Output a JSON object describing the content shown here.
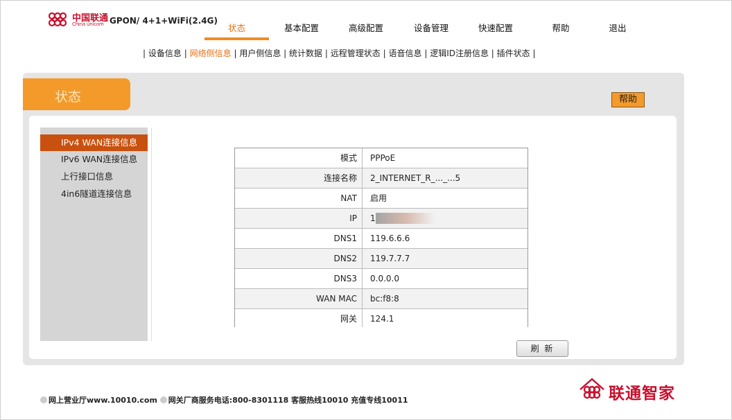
{
  "header": {
    "logo_cn": "中国联通",
    "logo_en": "China unicom",
    "model": "GPON/ 4+1+WiFi(2.4G)",
    "nav": [
      {
        "label": "状态",
        "active": true
      },
      {
        "label": "基本配置",
        "active": false
      },
      {
        "label": "高级配置",
        "active": false
      },
      {
        "label": "设备管理",
        "active": false
      },
      {
        "label": "快速配置",
        "active": false
      },
      {
        "label": "帮助",
        "active": false
      },
      {
        "label": "退出",
        "active": false
      }
    ],
    "subnav": [
      {
        "label": "设备信息",
        "active": false
      },
      {
        "label": "网络侧信息",
        "active": true
      },
      {
        "label": "用户侧信息",
        "active": false
      },
      {
        "label": "统计数据",
        "active": false
      },
      {
        "label": "远程管理状态",
        "active": false
      },
      {
        "label": "语音信息",
        "active": false
      },
      {
        "label": "逻辑ID注册信息",
        "active": false
      },
      {
        "label": "插件状态",
        "active": false
      }
    ],
    "subnav_sep": "|"
  },
  "panel": {
    "title": "状态",
    "help_label": "帮助",
    "refresh_label": "刷 新"
  },
  "sidebar": {
    "items": [
      {
        "label": "IPv4 WAN连接信息",
        "active": true
      },
      {
        "label": "IPv6 WAN连接信息",
        "active": false
      },
      {
        "label": "上行接口信息",
        "active": false
      },
      {
        "label": "4in6隧道连接信息",
        "active": false
      }
    ]
  },
  "info": {
    "rows": [
      {
        "key": "模式",
        "value": "PPPoE"
      },
      {
        "key": "连接名称",
        "value": "2_INTERNET_R_..._...5"
      },
      {
        "key": "NAT",
        "value": "启用"
      },
      {
        "key": "IP",
        "value": "1"
      },
      {
        "key": "DNS1",
        "value": "119.6.6.6"
      },
      {
        "key": "DNS2",
        "value": "119.7.7.7"
      },
      {
        "key": "DNS3",
        "value": "0.0.0.0"
      },
      {
        "key": "WAN MAC",
        "value": "bc:f8:8"
      },
      {
        "key": "网关",
        "value": "124.1"
      }
    ]
  },
  "footer": {
    "left_1": "网上营业厅www.10010.com",
    "left_2": "网关厂商服务电话:800-8301118 客服热线10010 充值专线10011",
    "brand": "联通智家"
  },
  "colors": {
    "accent": "#f39a2b",
    "active_nav": "#e57117",
    "sidebar_active": "#c9510f",
    "brand_red": "#c8102e"
  }
}
